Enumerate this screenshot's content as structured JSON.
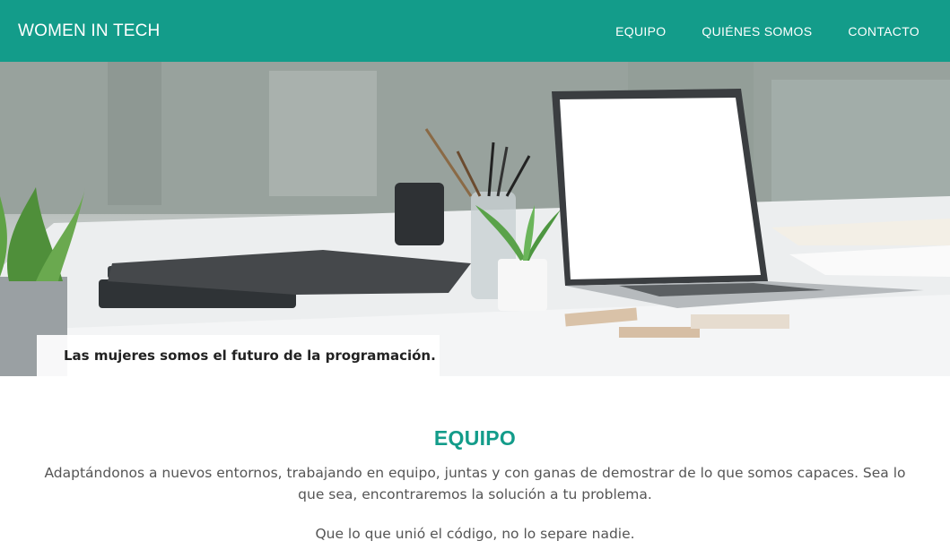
{
  "header": {
    "brand": "WOMEN IN TECH",
    "nav": [
      "EQUIPO",
      "QUIÉNES SOMOS",
      "CONTACTO"
    ],
    "background_color": "#139c8a"
  },
  "hero": {
    "caption": "Las mujeres somos el futuro de la programación."
  },
  "team_section": {
    "heading": "EQUIPO",
    "paragraph_1": "Adaptándonos a nuevos entornos, trabajando en equipo, juntas y con ganas de demostrar de lo que somos capaces. Sea lo que sea, encontraremos la solución a tu problema.",
    "paragraph_2": "Que lo que unió el código, no lo separe nadie.",
    "heading_color": "#139c8a"
  }
}
